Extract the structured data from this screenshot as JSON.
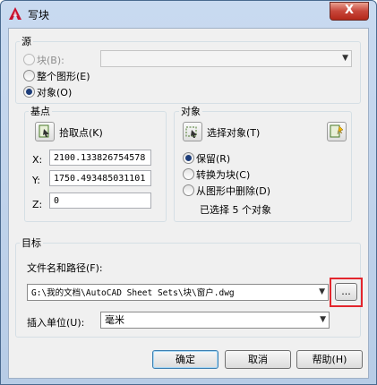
{
  "window": {
    "title": "写块",
    "close_label": "X"
  },
  "source": {
    "legend": "源",
    "block_label": "块(B):",
    "block_value": "",
    "entire_drawing_label": "整个图形(E)",
    "objects_label": "对象(O)",
    "selected": "objects"
  },
  "base_point": {
    "legend": "基点",
    "pick_point_label": "拾取点(K)",
    "x_label": "X:",
    "x_value": "2100.133826754578",
    "y_label": "Y:",
    "y_value": "1750.493485031101",
    "z_label": "Z:",
    "z_value": "0"
  },
  "objects": {
    "legend": "对象",
    "select_objects_label": "选择对象(T)",
    "retain_label": "保留(R)",
    "convert_label": "转换为块(C)",
    "delete_label": "从图形中删除(D)",
    "selected_mode": "retain",
    "selection_status": "已选择 5 个对象"
  },
  "destination": {
    "legend": "目标",
    "filename_label": "文件名和路径(F):",
    "filename_value": "G:\\我的文档\\AutoCAD Sheet Sets\\块\\窗户.dwg",
    "browse_label": "...",
    "units_label": "插入单位(U):",
    "units_value": "毫米"
  },
  "buttons": {
    "ok": "确定",
    "cancel": "取消",
    "help": "帮助(H)"
  },
  "colors": {
    "highlight": "#e3262d",
    "title_bar": "#c9daf0",
    "close_button": "#c7463a"
  }
}
